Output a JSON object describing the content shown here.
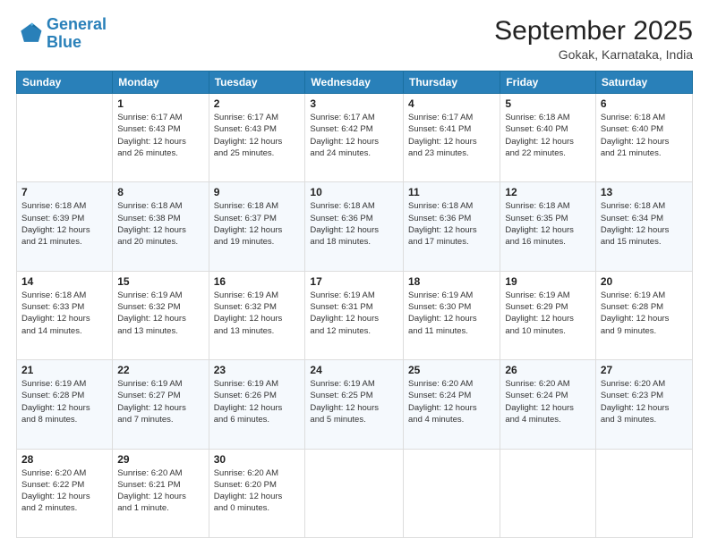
{
  "logo": {
    "line1": "General",
    "line2": "Blue"
  },
  "header": {
    "month": "September 2025",
    "location": "Gokak, Karnataka, India"
  },
  "weekdays": [
    "Sunday",
    "Monday",
    "Tuesday",
    "Wednesday",
    "Thursday",
    "Friday",
    "Saturday"
  ],
  "weeks": [
    [
      {
        "day": "",
        "info": ""
      },
      {
        "day": "1",
        "info": "Sunrise: 6:17 AM\nSunset: 6:43 PM\nDaylight: 12 hours\nand 26 minutes."
      },
      {
        "day": "2",
        "info": "Sunrise: 6:17 AM\nSunset: 6:43 PM\nDaylight: 12 hours\nand 25 minutes."
      },
      {
        "day": "3",
        "info": "Sunrise: 6:17 AM\nSunset: 6:42 PM\nDaylight: 12 hours\nand 24 minutes."
      },
      {
        "day": "4",
        "info": "Sunrise: 6:17 AM\nSunset: 6:41 PM\nDaylight: 12 hours\nand 23 minutes."
      },
      {
        "day": "5",
        "info": "Sunrise: 6:18 AM\nSunset: 6:40 PM\nDaylight: 12 hours\nand 22 minutes."
      },
      {
        "day": "6",
        "info": "Sunrise: 6:18 AM\nSunset: 6:40 PM\nDaylight: 12 hours\nand 21 minutes."
      }
    ],
    [
      {
        "day": "7",
        "info": "Sunrise: 6:18 AM\nSunset: 6:39 PM\nDaylight: 12 hours\nand 21 minutes."
      },
      {
        "day": "8",
        "info": "Sunrise: 6:18 AM\nSunset: 6:38 PM\nDaylight: 12 hours\nand 20 minutes."
      },
      {
        "day": "9",
        "info": "Sunrise: 6:18 AM\nSunset: 6:37 PM\nDaylight: 12 hours\nand 19 minutes."
      },
      {
        "day": "10",
        "info": "Sunrise: 6:18 AM\nSunset: 6:36 PM\nDaylight: 12 hours\nand 18 minutes."
      },
      {
        "day": "11",
        "info": "Sunrise: 6:18 AM\nSunset: 6:36 PM\nDaylight: 12 hours\nand 17 minutes."
      },
      {
        "day": "12",
        "info": "Sunrise: 6:18 AM\nSunset: 6:35 PM\nDaylight: 12 hours\nand 16 minutes."
      },
      {
        "day": "13",
        "info": "Sunrise: 6:18 AM\nSunset: 6:34 PM\nDaylight: 12 hours\nand 15 minutes."
      }
    ],
    [
      {
        "day": "14",
        "info": "Sunrise: 6:18 AM\nSunset: 6:33 PM\nDaylight: 12 hours\nand 14 minutes."
      },
      {
        "day": "15",
        "info": "Sunrise: 6:19 AM\nSunset: 6:32 PM\nDaylight: 12 hours\nand 13 minutes."
      },
      {
        "day": "16",
        "info": "Sunrise: 6:19 AM\nSunset: 6:32 PM\nDaylight: 12 hours\nand 13 minutes."
      },
      {
        "day": "17",
        "info": "Sunrise: 6:19 AM\nSunset: 6:31 PM\nDaylight: 12 hours\nand 12 minutes."
      },
      {
        "day": "18",
        "info": "Sunrise: 6:19 AM\nSunset: 6:30 PM\nDaylight: 12 hours\nand 11 minutes."
      },
      {
        "day": "19",
        "info": "Sunrise: 6:19 AM\nSunset: 6:29 PM\nDaylight: 12 hours\nand 10 minutes."
      },
      {
        "day": "20",
        "info": "Sunrise: 6:19 AM\nSunset: 6:28 PM\nDaylight: 12 hours\nand 9 minutes."
      }
    ],
    [
      {
        "day": "21",
        "info": "Sunrise: 6:19 AM\nSunset: 6:28 PM\nDaylight: 12 hours\nand 8 minutes."
      },
      {
        "day": "22",
        "info": "Sunrise: 6:19 AM\nSunset: 6:27 PM\nDaylight: 12 hours\nand 7 minutes."
      },
      {
        "day": "23",
        "info": "Sunrise: 6:19 AM\nSunset: 6:26 PM\nDaylight: 12 hours\nand 6 minutes."
      },
      {
        "day": "24",
        "info": "Sunrise: 6:19 AM\nSunset: 6:25 PM\nDaylight: 12 hours\nand 5 minutes."
      },
      {
        "day": "25",
        "info": "Sunrise: 6:20 AM\nSunset: 6:24 PM\nDaylight: 12 hours\nand 4 minutes."
      },
      {
        "day": "26",
        "info": "Sunrise: 6:20 AM\nSunset: 6:24 PM\nDaylight: 12 hours\nand 4 minutes."
      },
      {
        "day": "27",
        "info": "Sunrise: 6:20 AM\nSunset: 6:23 PM\nDaylight: 12 hours\nand 3 minutes."
      }
    ],
    [
      {
        "day": "28",
        "info": "Sunrise: 6:20 AM\nSunset: 6:22 PM\nDaylight: 12 hours\nand 2 minutes."
      },
      {
        "day": "29",
        "info": "Sunrise: 6:20 AM\nSunset: 6:21 PM\nDaylight: 12 hours\nand 1 minute."
      },
      {
        "day": "30",
        "info": "Sunrise: 6:20 AM\nSunset: 6:20 PM\nDaylight: 12 hours\nand 0 minutes."
      },
      {
        "day": "",
        "info": ""
      },
      {
        "day": "",
        "info": ""
      },
      {
        "day": "",
        "info": ""
      },
      {
        "day": "",
        "info": ""
      }
    ]
  ]
}
